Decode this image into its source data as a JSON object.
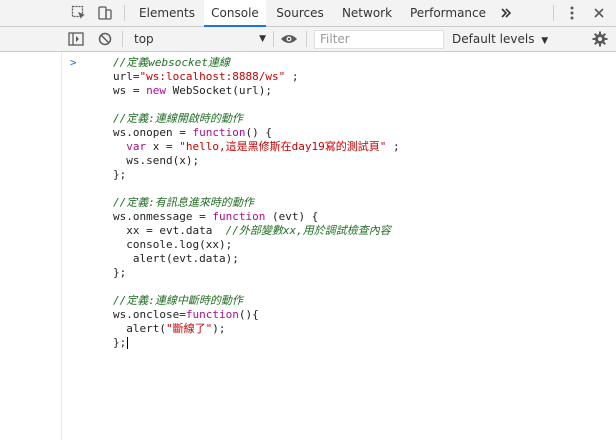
{
  "tabbar": {
    "inspect_icon": "inspect-element-icon",
    "device_icon": "device-toolbar-icon",
    "tabs": [
      {
        "label": "Elements"
      },
      {
        "label": "Console"
      },
      {
        "label": "Sources"
      },
      {
        "label": "Network"
      },
      {
        "label": "Performance"
      }
    ],
    "more_tabs_icon": "double-chevron-icon",
    "menu_icon": "kebab-menu-icon",
    "close_icon": "close-icon",
    "active_tab": "Console"
  },
  "toolbar": {
    "sidebar_icon": "console-sidebar-icon",
    "clear_icon": "clear-console-icon",
    "context_value": "top",
    "eye_icon": "live-expression-eye-icon",
    "filter_placeholder": "Filter",
    "levels_label": "Default levels",
    "settings_icon": "gear-icon"
  },
  "console": {
    "prompt": ">",
    "lines": [
      {
        "parts": [
          {
            "t": "cm",
            "v": "//定義websocket連線"
          }
        ]
      },
      {
        "parts": [
          {
            "t": "p",
            "v": "url="
          },
          {
            "t": "str",
            "v": "\"ws:localhost:8888/ws\""
          },
          {
            "t": "p",
            "v": " ;"
          }
        ]
      },
      {
        "parts": [
          {
            "t": "p",
            "v": "ws = "
          },
          {
            "t": "kw",
            "v": "new"
          },
          {
            "t": "p",
            "v": " WebSocket(url);"
          }
        ]
      },
      {
        "parts": []
      },
      {
        "parts": [
          {
            "t": "cm",
            "v": "//定義:連線開啟時的動作"
          }
        ]
      },
      {
        "parts": [
          {
            "t": "p",
            "v": "ws.onopen = "
          },
          {
            "t": "kw",
            "v": "function"
          },
          {
            "t": "p",
            "v": "() {"
          }
        ]
      },
      {
        "parts": [
          {
            "t": "p",
            "v": "  "
          },
          {
            "t": "kw",
            "v": "var"
          },
          {
            "t": "p",
            "v": " x = "
          },
          {
            "t": "str",
            "v": "\"hello,這是黑修斯在day19寫的測試頁\""
          },
          {
            "t": "p",
            "v": " ;"
          }
        ]
      },
      {
        "parts": [
          {
            "t": "p",
            "v": "  ws.send(x);"
          }
        ]
      },
      {
        "parts": [
          {
            "t": "p",
            "v": "};"
          }
        ]
      },
      {
        "parts": []
      },
      {
        "parts": [
          {
            "t": "cm",
            "v": "//定義:有訊息進來時的動作"
          }
        ]
      },
      {
        "parts": [
          {
            "t": "p",
            "v": "ws.onmessage = "
          },
          {
            "t": "kw",
            "v": "function"
          },
          {
            "t": "p",
            "v": " (evt) {"
          }
        ]
      },
      {
        "parts": [
          {
            "t": "p",
            "v": "  xx = evt.data  "
          },
          {
            "t": "cm",
            "v": "//外部變數xx,用於調試檢查內容"
          }
        ]
      },
      {
        "parts": [
          {
            "t": "p",
            "v": "  console.log(xx);"
          }
        ]
      },
      {
        "parts": [
          {
            "t": "p",
            "v": "   alert(evt.data);"
          }
        ]
      },
      {
        "parts": [
          {
            "t": "p",
            "v": "};"
          }
        ]
      },
      {
        "parts": []
      },
      {
        "parts": [
          {
            "t": "cm",
            "v": "//定義:連線中斷時的動作"
          }
        ]
      },
      {
        "parts": [
          {
            "t": "p",
            "v": "ws.onclose="
          },
          {
            "t": "kw",
            "v": "function"
          },
          {
            "t": "p",
            "v": "(){"
          }
        ]
      },
      {
        "parts": [
          {
            "t": "p",
            "v": "  alert("
          },
          {
            "t": "str",
            "v": "\"斷線了\""
          },
          {
            "t": "p",
            "v": ");"
          }
        ]
      },
      {
        "parts": [
          {
            "t": "p",
            "v": "};"
          }
        ],
        "cursor": true
      }
    ]
  }
}
